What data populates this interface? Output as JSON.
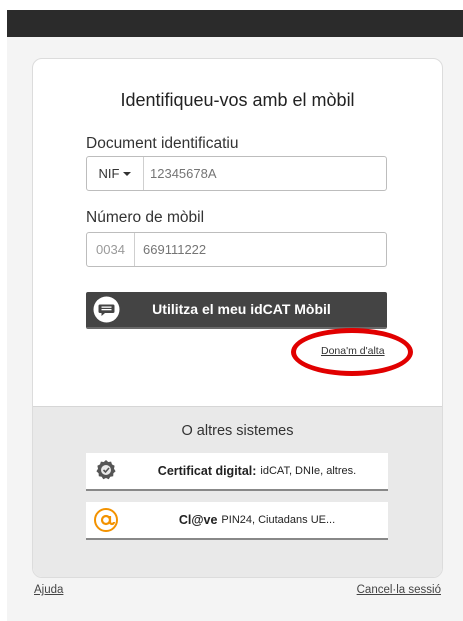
{
  "card": {
    "title": "Identifiqueu-vos amb el mòbil",
    "document_label": "Document identificatiu",
    "document_type": "NIF",
    "document_placeholder": "12345678A",
    "mobile_label": "Número de mòbil",
    "mobile_prefix": "0034",
    "mobile_placeholder": "669111222",
    "mobil_button": "Utilitza el meu idCAT Mòbil",
    "signup_link": "Dona'm d'alta"
  },
  "alternatives": {
    "title": "O altres sistemes",
    "certificat_strong": "Certificat digital:",
    "certificat_detail": "idCAT, DNIe, altres.",
    "clave_strong": "Cl@ve",
    "clave_detail": "PIN24, Ciutadans UE..."
  },
  "footer": {
    "help": "Ajuda",
    "logout": "Cancel·la sessió"
  },
  "colors": {
    "highlight_oval": "#e10000",
    "top_bar": "#2b2b2b",
    "primary_button": "#444444",
    "clave_orange": "#f39200"
  },
  "icons": {
    "mobil_button": "chat-bubble-icon",
    "certificat": "certificate-badge-icon",
    "clave": "clave-at-icon"
  }
}
